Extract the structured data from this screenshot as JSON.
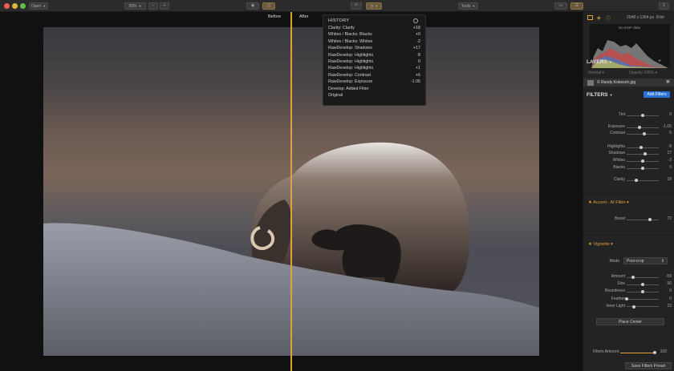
{
  "toolbar": {
    "open_label": "Open",
    "zoom_label": "99%",
    "tools_label": "Tools"
  },
  "canvas": {
    "before_label": "Before",
    "after_label": "After"
  },
  "history": {
    "title": "HISTORY",
    "items": [
      {
        "name": "Clarity: Clarity",
        "value": "+18"
      },
      {
        "name": "Whites / Blacks: Blacks",
        "value": "+0"
      },
      {
        "name": "Whites / Blacks: Whites",
        "value": "-2"
      },
      {
        "name": "RawDevelop: Shadows",
        "value": "+17"
      },
      {
        "name": "RawDevelop: Highlights",
        "value": "-8"
      },
      {
        "name": "RawDevelop: Highlights",
        "value": "0"
      },
      {
        "name": "RawDevelop: Highlights",
        "value": "+1"
      },
      {
        "name": "RawDevelop: Contrast",
        "value": "+6"
      },
      {
        "name": "RawDevelop: Exposure",
        "value": "-1.05"
      },
      {
        "name": "Develop: Added Filter",
        "value": ""
      },
      {
        "name": "Original",
        "value": ""
      }
    ]
  },
  "panel": {
    "dimensions": "2048 x 1364 px",
    "bit_depth": "8-bit",
    "exif": "No EXIF data",
    "layers_title": "LAYERS",
    "blend_mode": "Normal",
    "opacity": "Opacity 100%",
    "layer_name": "© Randy Kokesch.jpg",
    "filters_title": "FILTERS",
    "add_filters": "Add Filters",
    "develop": [
      {
        "label": "Tint",
        "value": "0",
        "pos": 0.5
      },
      {
        "label": "Exposure",
        "value": "-1.05",
        "pos": 0.4
      },
      {
        "label": "Contrast",
        "value": "6",
        "pos": 0.55
      },
      {
        "label": "Highlights",
        "value": "-8",
        "pos": 0.46
      },
      {
        "label": "Shadows",
        "value": "17",
        "pos": 0.58
      },
      {
        "label": "Whites",
        "value": "-2",
        "pos": 0.49
      },
      {
        "label": "Blacks",
        "value": "0",
        "pos": 0.5
      },
      {
        "label": "Clarity",
        "value": "18",
        "pos": 0.3
      }
    ],
    "accent_title": "Accent - AI Filter",
    "accent": [
      {
        "label": "Boost",
        "value": "72",
        "pos": 0.72
      }
    ],
    "vignette_title": "Vignette",
    "vignette_mode_label": "Mode",
    "vignette_mode": "Post-crop",
    "vignette": [
      {
        "label": "Amount",
        "value": "-59",
        "pos": 0.21
      },
      {
        "label": "Size",
        "value": "50",
        "pos": 0.5
      },
      {
        "label": "Roundness",
        "value": "0",
        "pos": 0.5
      },
      {
        "label": "Feather",
        "value": "0",
        "pos": 0.0
      },
      {
        "label": "Inner Light",
        "value": "23",
        "pos": 0.23
      }
    ],
    "place_center": "Place Center",
    "filters_amount_label": "Filters Amount",
    "filters_amount_value": "100",
    "save_preset": "Save Filters Preset"
  },
  "colors": {
    "accent": "#e0a03a",
    "add_filters_bg": "#2a72d5"
  }
}
